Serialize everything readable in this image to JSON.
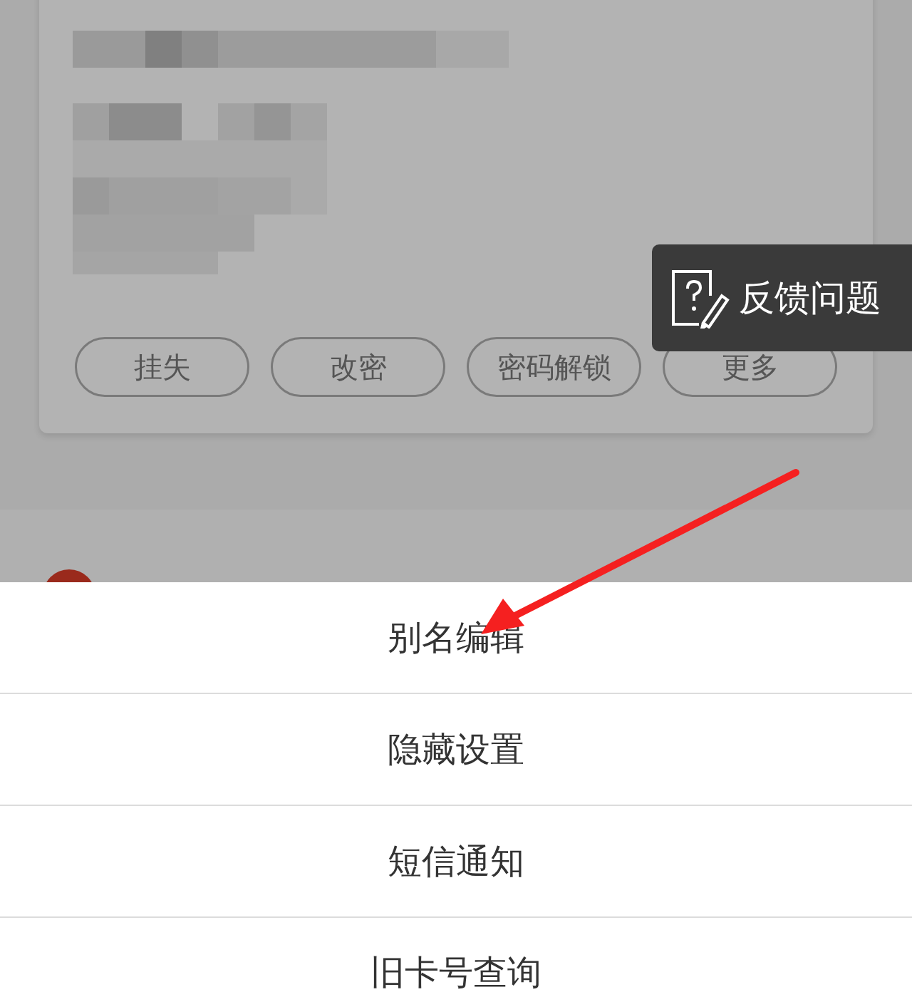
{
  "card": {
    "actions": [
      {
        "label": "挂失"
      },
      {
        "label": "改密"
      },
      {
        "label": "密码解锁"
      },
      {
        "label": "更多"
      }
    ]
  },
  "feedback": {
    "label": "反馈问题"
  },
  "sheet": {
    "items": [
      {
        "label": "别名编辑"
      },
      {
        "label": "隐藏设置"
      },
      {
        "label": "短信通知"
      },
      {
        "label": "旧卡号查询"
      }
    ]
  }
}
